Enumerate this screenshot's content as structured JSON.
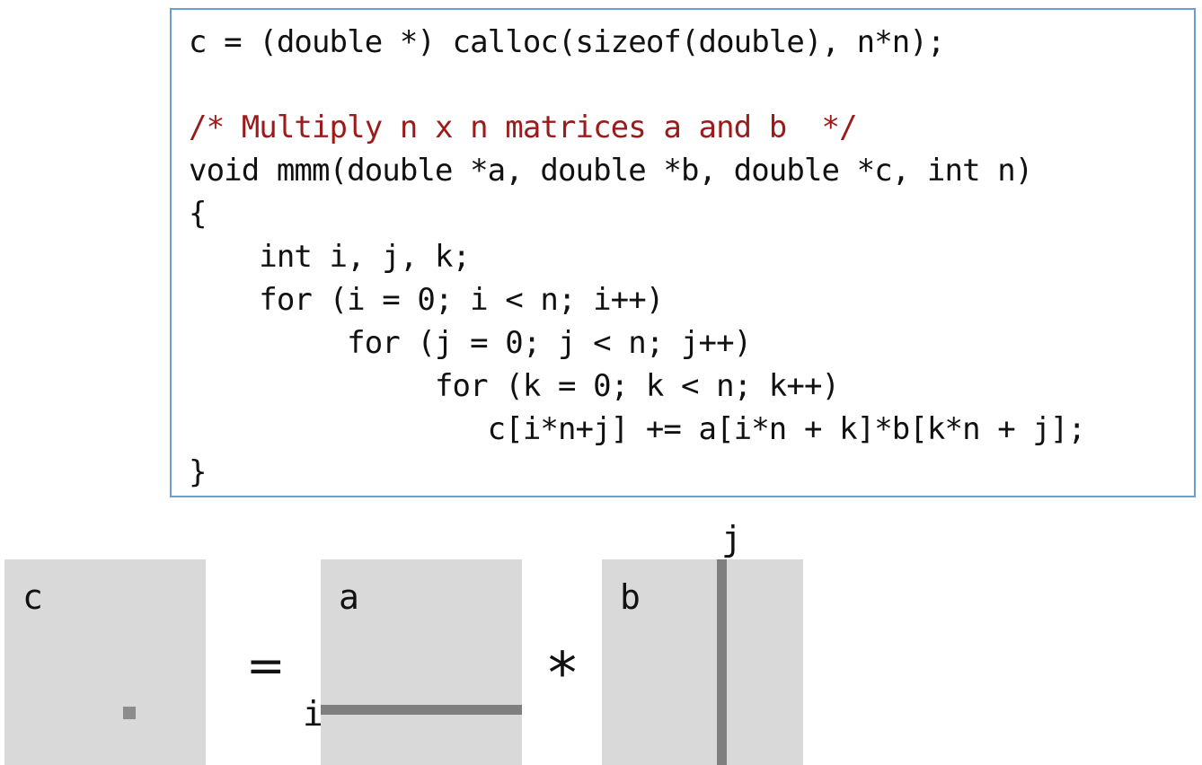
{
  "code": {
    "line1": "c = (double *) calloc(sizeof(double), n*n);",
    "line2": "",
    "line3": "/* Multiply n x n matrices a and b  */",
    "line4": "void mmm(double *a, double *b, double *c, int n)",
    "line5": "{",
    "line6": "    int i, j, k;",
    "line7": "    for (i = 0; i < n; i++)",
    "line8": "         for (j = 0; j < n; j++)",
    "line9": "              for (k = 0; k < n; k++)",
    "line10": "                 c[i*n+j] += a[i*n + k]*b[k*n + j];",
    "line11": "}"
  },
  "diagram": {
    "matrix_c_label": "c",
    "matrix_a_label": "a",
    "matrix_b_label": "b",
    "equals_symbol": "=",
    "times_symbol": "*",
    "row_index_label": "i",
    "col_index_label": "j"
  },
  "colors": {
    "comment": "#9b1b1b",
    "box_border": "#6a9fd4",
    "matrix_fill": "#d9d9d9",
    "highlight": "#7f7f7f"
  }
}
